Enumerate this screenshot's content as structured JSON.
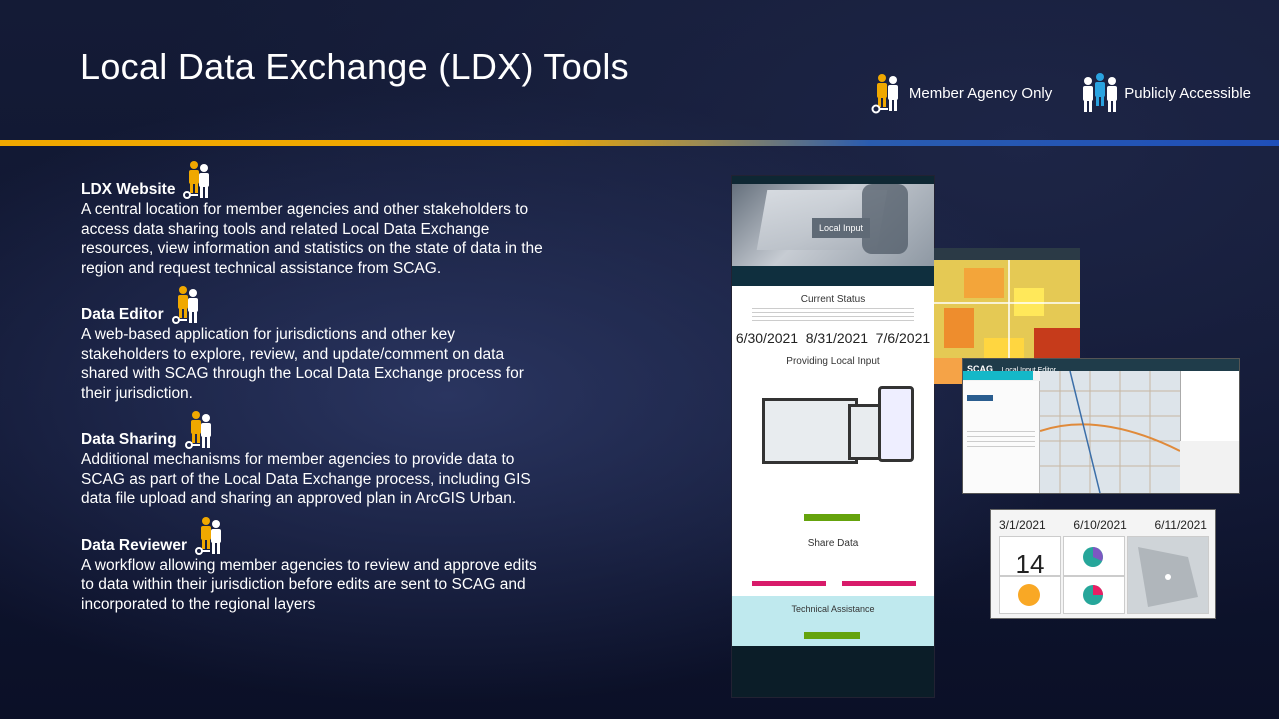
{
  "title": "Local Data Exchange (LDX) Tools",
  "legend": {
    "member_label": "Member Agency Only",
    "public_label": "Publicly Accessible"
  },
  "colors": {
    "gold": "#f0a800",
    "blue": "#2aa3e0",
    "white": "#ffffff"
  },
  "tools": [
    {
      "name": "LDX Website",
      "icon": "member-and-public-icon",
      "desc_lines": [
        "A central location for member agencies and other stakeholders to",
        "access data sharing tools and related Local Data Exchange",
        "resources, view information and statistics on the state of data in the",
        "region and request technical assistance from SCAG."
      ]
    },
    {
      "name": "Data Editor",
      "icon": "member-agency-only-icon",
      "desc_lines": [
        "A web-based application for jurisdictions and other key",
        "stakeholders to explore, review, and update/comment on data",
        "shared with SCAG through the Local Data Exchange process for",
        "their jurisdiction."
      ]
    },
    {
      "name": "Data Sharing",
      "icon": "member-agency-only-icon",
      "desc_lines": [
        "Additional mechanisms for member agencies to provide data to",
        "SCAG as part of the Local Data Exchange process, including GIS",
        "data file upload and sharing an approved plan in ArcGIS Urban."
      ]
    },
    {
      "name": "Data Reviewer",
      "icon": "member-agency-only-icon",
      "desc_lines": [
        "A workflow allowing member agencies to review and approve edits",
        "to data within their jurisdiction before edits are sent to SCAG and",
        "incorporated to the regional layers"
      ]
    }
  ],
  "screenshots": {
    "website": {
      "hero_button": "Local Input",
      "current_status": "Current Status",
      "dates": [
        "6/30/2021",
        "8/31/2021",
        "7/6/2021"
      ],
      "providing": "Providing Local Input",
      "share_data": "Share Data",
      "tech_assist": "Technical Assistance"
    },
    "editor": {
      "app_title": "Local Input Editor",
      "brand": "SCAG"
    },
    "dashboard": {
      "dates": [
        "3/1/2021",
        "6/10/2021",
        "6/11/2021"
      ],
      "count": "14"
    }
  }
}
